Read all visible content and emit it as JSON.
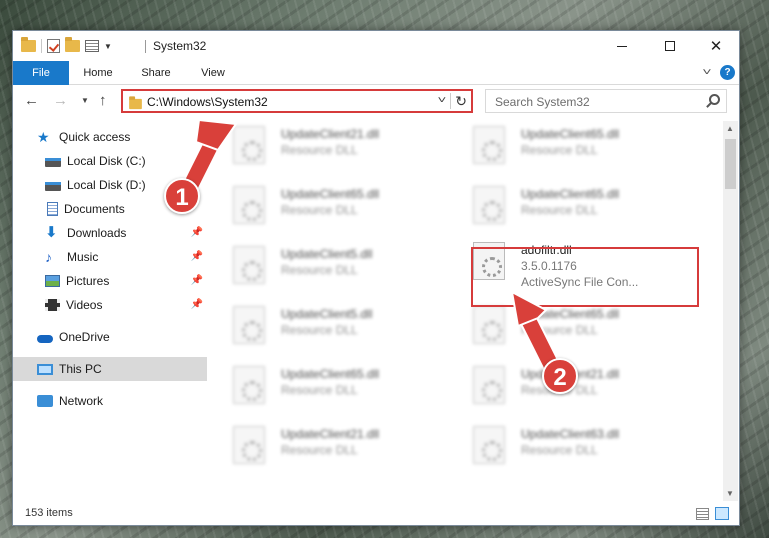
{
  "window": {
    "title": "System32"
  },
  "ribbon": {
    "tabs": [
      "File",
      "Home",
      "Share",
      "View"
    ]
  },
  "nav": {
    "address": "C:\\Windows\\System32",
    "search_placeholder": "Search System32"
  },
  "sidebar": {
    "items": [
      {
        "label": "Quick access",
        "icon": "star-icon"
      },
      {
        "label": "Local Disk (C:)",
        "icon": "disk-icon"
      },
      {
        "label": "Local Disk (D:)",
        "icon": "disk-icon"
      },
      {
        "label": "Documents",
        "icon": "documents-icon"
      },
      {
        "label": "Downloads",
        "icon": "downloads-icon"
      },
      {
        "label": "Music",
        "icon": "music-icon"
      },
      {
        "label": "Pictures",
        "icon": "pictures-icon"
      },
      {
        "label": "Videos",
        "icon": "videos-icon"
      },
      {
        "label": "OneDrive",
        "icon": "onedrive-icon"
      },
      {
        "label": "This PC",
        "icon": "pc-icon"
      },
      {
        "label": "Network",
        "icon": "network-icon"
      }
    ]
  },
  "files": {
    "left": [
      {
        "name": "UpdateClient21.dll",
        "type": "Resource DLL"
      },
      {
        "name": "UpdateClient65.dll",
        "type": "Resource DLL"
      },
      {
        "name": "UpdateClient5.dll",
        "type": "Resource DLL"
      },
      {
        "name": "UpdateClient5.dll",
        "type": "Resource DLL"
      },
      {
        "name": "UpdateClient65.dll",
        "type": "Resource DLL"
      },
      {
        "name": "UpdateClient21.dll",
        "type": "Resource DLL"
      }
    ],
    "right": [
      {
        "name": "UpdateClient65.dll",
        "type": "Resource DLL"
      },
      {
        "name": "UpdateClient65.dll",
        "type": "Resource DLL"
      },
      {
        "name": "UpdateClient65.dll",
        "type": "Resource DLL"
      },
      {
        "name": "UpdateClient21.dll",
        "type": "Resource DLL"
      },
      {
        "name": "UpdateClient63.dll",
        "type": "Resource DLL"
      }
    ],
    "highlighted": {
      "name": "adofiltr.dll",
      "version": "3.5.0.1176",
      "description": "ActiveSync File Con..."
    }
  },
  "status": {
    "items_count": "153 items"
  },
  "callouts": [
    "1",
    "2"
  ],
  "colors": {
    "accent": "#1979ca",
    "highlight_red": "#d63b3b",
    "callout_red": "#d9403a"
  }
}
